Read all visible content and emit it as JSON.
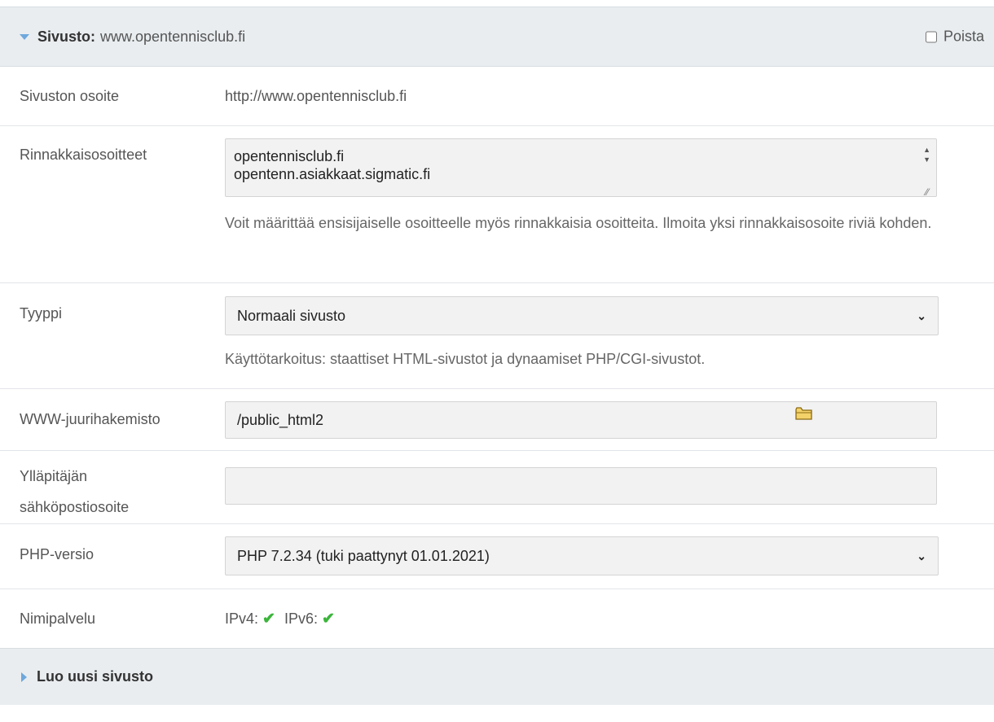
{
  "header": {
    "label": "Sivusto:",
    "value": "www.opentennisclub.fi",
    "delete_label": "Poista"
  },
  "rows": {
    "address": {
      "label": "Sivuston osoite",
      "value": "http://www.opentennisclub.fi"
    },
    "aliases": {
      "label": "Rinnakkaisosoitteet",
      "value": "opentennisclub.fi\nopentenn.asiakkaat.sigmatic.fi",
      "help": "Voit määrittää ensisijaiselle osoitteelle myös rinnakkaisia osoitteita. Ilmoita yksi rinnakkaisosoite riviä kohden."
    },
    "type": {
      "label": "Tyyppi",
      "selected": "Normaali sivusto",
      "help": "Käyttötarkoitus: staattiset HTML-sivustot ja dynaamiset PHP/CGI-sivustot."
    },
    "webroot": {
      "label": "WWW-juurihakemisto",
      "value": "/public_html2"
    },
    "admin_email": {
      "label_line1": "Ylläpitäjän",
      "label_line2": "sähköpostiosoite",
      "value": ""
    },
    "php": {
      "label": "PHP-versio",
      "selected": "PHP 7.2.34 (tuki paattynyt 01.01.2021)"
    },
    "dns": {
      "label": "Nimipalvelu",
      "ipv4": "IPv4:",
      "ipv6": "IPv6:"
    }
  },
  "footer": {
    "label": "Luo uusi sivusto"
  },
  "colors": {
    "accent": "#6ea8dc",
    "ok": "#3bb53b",
    "panel": "#e9edf0"
  },
  "icons": {
    "expand": "triangle-down-icon",
    "collapsed": "triangle-right-icon",
    "folder": "folder-icon",
    "ok": "check-icon"
  }
}
